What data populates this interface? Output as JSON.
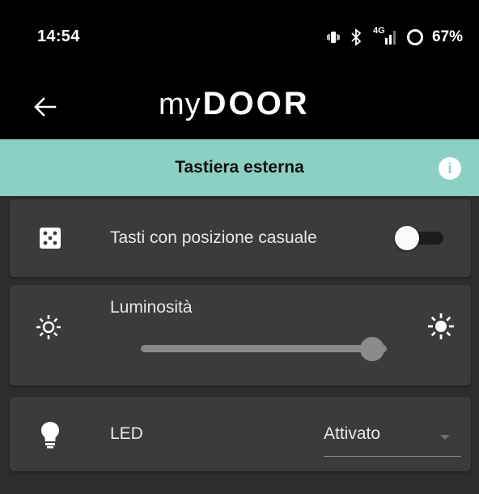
{
  "status_bar": {
    "time": "14:54",
    "network": "4G",
    "battery": "67%"
  },
  "app_bar": {
    "logo_prefix": "my",
    "logo_main": "DOOR"
  },
  "section": {
    "title": "Tastiera esterna"
  },
  "settings": {
    "random_keys": {
      "label": "Tasti con posizione casuale",
      "enabled": false,
      "icon": "dice-icon"
    },
    "brightness": {
      "label": "Luminosità",
      "level": 0.94
    },
    "led": {
      "label": "LED",
      "value": "Attivato",
      "icon": "lightbulb-icon"
    }
  },
  "colors": {
    "accent": "#8ccfc3",
    "card": "#3b3b3b",
    "background": "#2d2d2d"
  }
}
